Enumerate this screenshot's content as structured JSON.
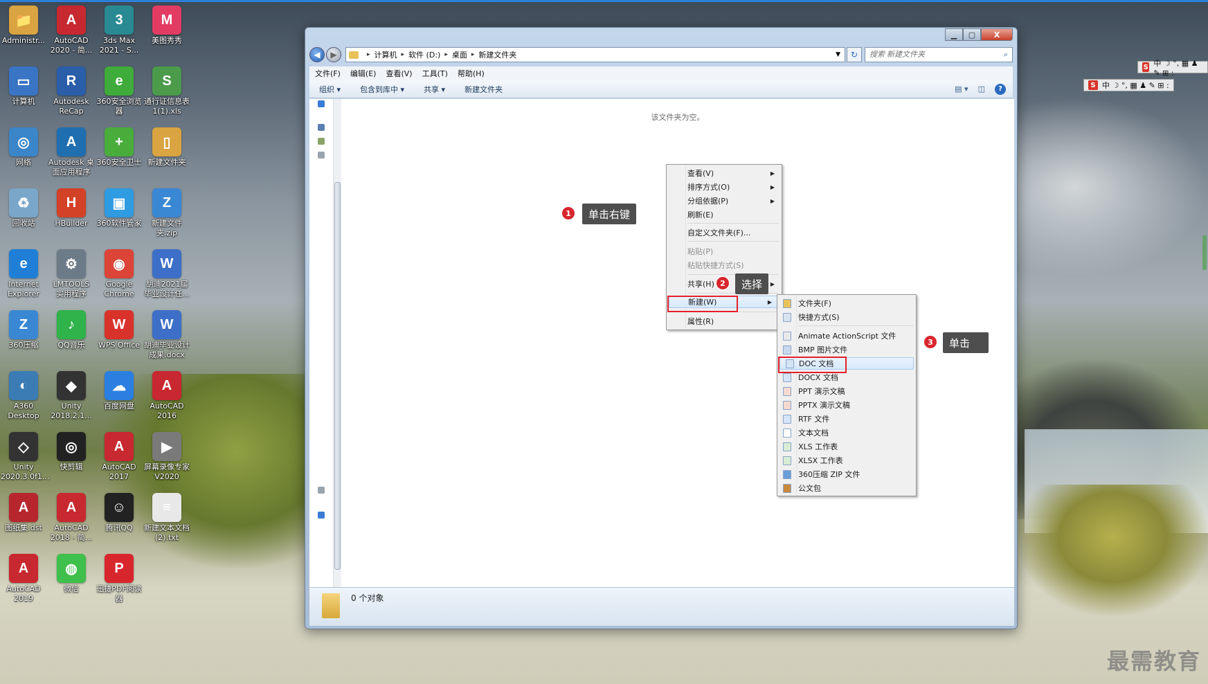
{
  "desktop_icons": [
    {
      "label": "Administr...",
      "icon": "user-folder-icon",
      "color": "#d9a441",
      "glyph": "📁"
    },
    {
      "label": "AutoCAD 2020 - 简...",
      "icon": "autocad-icon",
      "color": "#c8282f",
      "glyph": "A"
    },
    {
      "label": "3ds Max 2021 - S...",
      "icon": "3dsmax-icon",
      "color": "#2a8a93",
      "glyph": "3"
    },
    {
      "label": "美图秀秀",
      "icon": "meitu-icon",
      "color": "#e23c63",
      "glyph": "M"
    },
    {
      "label": "计算机",
      "icon": "computer-icon",
      "color": "#3a74c4",
      "glyph": "▭"
    },
    {
      "label": "Autodesk ReCap",
      "icon": "recap-icon",
      "color": "#2b5ea8",
      "glyph": "R"
    },
    {
      "label": "360安全浏览器",
      "icon": "360-browser-icon",
      "color": "#3fab3a",
      "glyph": "e"
    },
    {
      "label": "通行证信息表1(1).xls",
      "icon": "xls-file-icon",
      "color": "#4b9b4b",
      "glyph": "S"
    },
    {
      "label": "网络",
      "icon": "network-icon",
      "color": "#3a86c8",
      "glyph": "◎"
    },
    {
      "label": "Autodesk 桌面应用程序",
      "icon": "autodesk-app-icon",
      "color": "#1f6fb0",
      "glyph": "A"
    },
    {
      "label": "360安全卫士",
      "icon": "360-safe-icon",
      "color": "#49ad3c",
      "glyph": "+"
    },
    {
      "label": "新建文件夹",
      "icon": "folder-icon",
      "color": "#d9a441",
      "glyph": "▯"
    },
    {
      "label": "回收站",
      "icon": "recycle-bin-icon",
      "color": "#7aa7c9",
      "glyph": "♻"
    },
    {
      "label": "HBuilder",
      "icon": "hbuilder-icon",
      "color": "#d34127",
      "glyph": "H"
    },
    {
      "label": "360软件管家",
      "icon": "360-software-icon",
      "color": "#2f9be0",
      "glyph": "▣"
    },
    {
      "label": "新建文件夹.zip",
      "icon": "zip-icon",
      "color": "#3a88d4",
      "glyph": "Z"
    },
    {
      "label": "Internet Explorer",
      "icon": "ie-icon",
      "color": "#1f7fd6",
      "glyph": "e"
    },
    {
      "label": "LMTOOLS 实用程序",
      "icon": "lmtools-icon",
      "color": "#6d7a88",
      "glyph": "⚙"
    },
    {
      "label": "Google Chrome",
      "icon": "chrome-icon",
      "color": "#db4437",
      "glyph": "◉"
    },
    {
      "label": "胡迪2021届毕业设计任...",
      "icon": "docx-file-icon",
      "color": "#3d6fc8",
      "glyph": "W"
    },
    {
      "label": "360压缩",
      "icon": "360-zip-icon",
      "color": "#3a88d4",
      "glyph": "Z"
    },
    {
      "label": "QQ音乐",
      "icon": "qq-music-icon",
      "color": "#2fb34a",
      "glyph": "♪"
    },
    {
      "label": "WPS Office",
      "icon": "wps-icon",
      "color": "#d8322b",
      "glyph": "W"
    },
    {
      "label": "胡迪毕业设计成果.docx",
      "icon": "docx-file-icon",
      "color": "#3d6fc8",
      "glyph": "W"
    },
    {
      "label": "A360 Desktop",
      "icon": "a360-icon",
      "color": "#3b7cb5",
      "glyph": "◐"
    },
    {
      "label": "Unity 2018.2.1...",
      "icon": "unity-icon",
      "color": "#333333",
      "glyph": "◆"
    },
    {
      "label": "百度网盘",
      "icon": "baidu-netdisk-icon",
      "color": "#2b7fe0",
      "glyph": "☁"
    },
    {
      "label": "AutoCAD 2016",
      "icon": "autocad-icon",
      "color": "#c8282f",
      "glyph": "A"
    },
    {
      "label": "Unity 2020.3.0f1...",
      "icon": "unity-icon",
      "color": "#333333",
      "glyph": "◇"
    },
    {
      "label": "快剪辑",
      "icon": "kuaijianji-icon",
      "color": "#222222",
      "glyph": "◎"
    },
    {
      "label": "AutoCAD 2017",
      "icon": "autocad-icon",
      "color": "#c8282f",
      "glyph": "A"
    },
    {
      "label": "屏幕录像专家 V2020",
      "icon": "screen-recorder-icon",
      "color": "#7a7a7a",
      "glyph": "▶"
    },
    {
      "label": "图纸集.dst",
      "icon": "dst-file-icon",
      "color": "#b8262d",
      "glyph": "A"
    },
    {
      "label": "AutoCAD 2018 - 简...",
      "icon": "autocad-icon",
      "color": "#c8282f",
      "glyph": "A"
    },
    {
      "label": "腾讯QQ",
      "icon": "qq-icon",
      "color": "#222222",
      "glyph": "☺"
    },
    {
      "label": "新建文本文档(2).txt",
      "icon": "txt-file-icon",
      "color": "#e8e8e8",
      "glyph": "≡"
    },
    {
      "label": "AutoCAD 2019",
      "icon": "autocad-icon",
      "color": "#c8282f",
      "glyph": "A"
    },
    {
      "label": "微信",
      "icon": "wechat-icon",
      "color": "#3fbf4b",
      "glyph": "◍"
    },
    {
      "label": "迅捷PDF阅读器",
      "icon": "pdf-reader-icon",
      "color": "#d8262d",
      "glyph": "P"
    }
  ],
  "window": {
    "close_glyph": "X",
    "breadcrumb": [
      "计算机",
      "软件 (D:)",
      "桌面",
      "新建文件夹"
    ],
    "search_placeholder": "搜索 新建文件夹",
    "menubar": [
      "文件(F)",
      "编辑(E)",
      "查看(V)",
      "工具(T)",
      "帮助(H)"
    ],
    "toolbar": [
      "组织 ▾",
      "包含到库中 ▾",
      "共享 ▾",
      "新建文件夹"
    ],
    "empty_text": "该文件夹为空。",
    "item_count": "0 个对象"
  },
  "context_menu": {
    "view": "查看(V)",
    "sort": "排序方式(O)",
    "group": "分组依据(P)",
    "refresh": "刷新(E)",
    "customize": "自定义文件夹(F)...",
    "paste": "粘贴(P)",
    "paste_shortcut": "粘贴快捷方式(S)",
    "share": "共享(H)",
    "new": "新建(W)",
    "properties": "属性(R)"
  },
  "submenu": [
    {
      "label": "文件夹(F)",
      "icon": "folder-icon"
    },
    {
      "label": "快捷方式(S)",
      "icon": "shortcut-icon"
    },
    {
      "label": "Animate ActionScript 文件",
      "icon": "actionscript-file-icon"
    },
    {
      "label": "BMP 图片文件",
      "icon": "bmp-file-icon"
    },
    {
      "label": "DOC 文档",
      "icon": "doc-file-icon"
    },
    {
      "label": "DOCX 文档",
      "icon": "docx-file-icon"
    },
    {
      "label": "PPT 演示文稿",
      "icon": "ppt-file-icon"
    },
    {
      "label": "PPTX 演示文稿",
      "icon": "pptx-file-icon"
    },
    {
      "label": "RTF 文件",
      "icon": "rtf-file-icon"
    },
    {
      "label": "文本文档",
      "icon": "txt-file-icon"
    },
    {
      "label": "XLS 工作表",
      "icon": "xls-file-icon"
    },
    {
      "label": "XLSX 工作表",
      "icon": "xlsx-file-icon"
    },
    {
      "label": "360压缩 ZIP 文件",
      "icon": "zip-file-icon"
    },
    {
      "label": "公文包",
      "icon": "briefcase-icon"
    }
  ],
  "annotations": [
    {
      "num": "1",
      "text": "单击右键"
    },
    {
      "num": "2",
      "text": "选择"
    },
    {
      "num": "3",
      "text": "单击"
    }
  ],
  "ime": {
    "s": "S",
    "text": "中 ☽ °, ▦ ♟ ✎ ⊞ :"
  },
  "watermark": "最需教育"
}
